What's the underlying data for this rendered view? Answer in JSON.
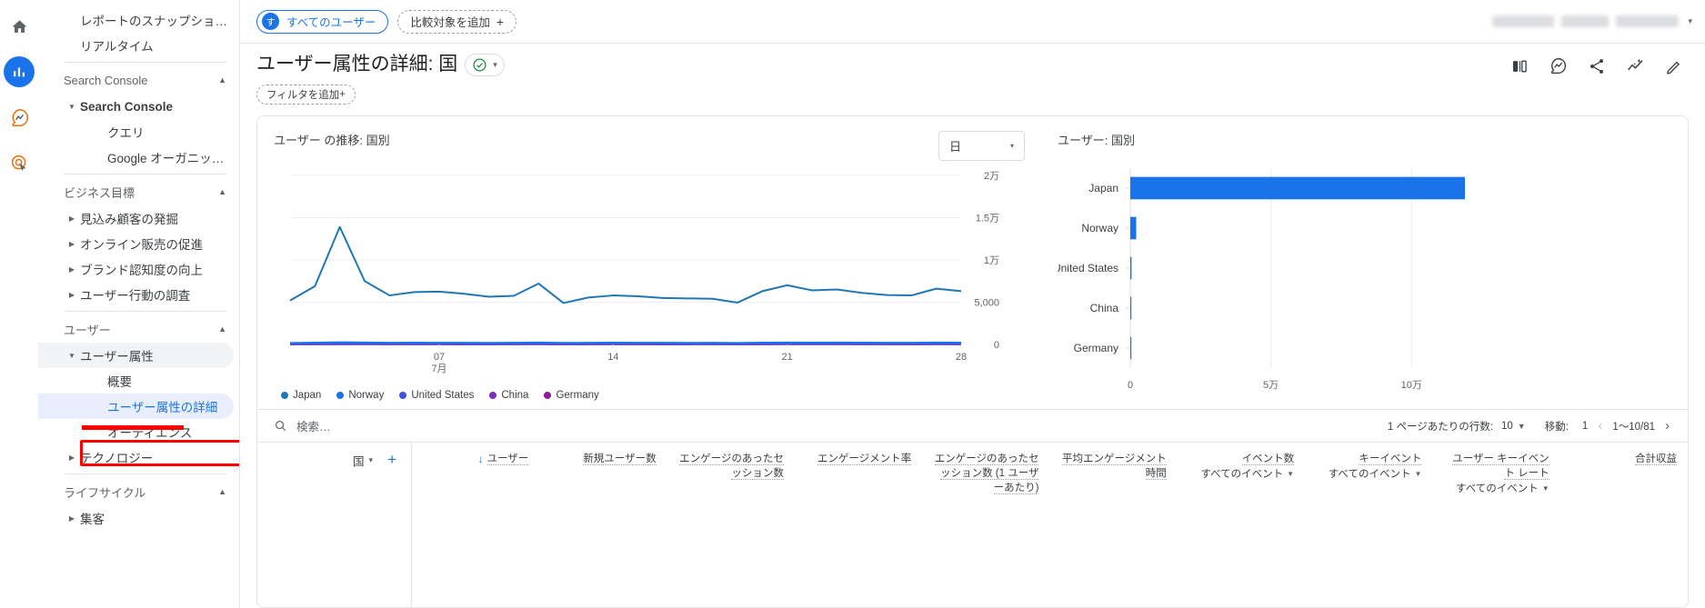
{
  "rail": {
    "items": [
      {
        "name": "home-icon",
        "label": "ホーム"
      },
      {
        "name": "reports-icon",
        "label": "レポート"
      },
      {
        "name": "explore-icon",
        "label": "探索"
      },
      {
        "name": "advertising-icon",
        "label": "広告"
      }
    ]
  },
  "sidebar": {
    "items": [
      {
        "label": "レポートのスナップショット",
        "type": "item"
      },
      {
        "label": "リアルタイム",
        "type": "item"
      },
      {
        "label": "Search Console",
        "type": "section"
      },
      {
        "label": "Search Console",
        "type": "expander-open",
        "bold": true
      },
      {
        "label": "クエリ",
        "type": "sub"
      },
      {
        "label": "Google オーガニック検索レ...",
        "type": "sub"
      },
      {
        "label": "ビジネス目標",
        "type": "section"
      },
      {
        "label": "見込み顧客の発掘",
        "type": "expander"
      },
      {
        "label": "オンライン販売の促進",
        "type": "expander"
      },
      {
        "label": "ブランド認知度の向上",
        "type": "expander"
      },
      {
        "label": "ユーザー行動の調査",
        "type": "expander"
      },
      {
        "label": "ユーザー",
        "type": "section"
      },
      {
        "label": "ユーザー属性",
        "type": "expander-open"
      },
      {
        "label": "概要",
        "type": "sub"
      },
      {
        "label": "ユーザー属性の詳細",
        "type": "sub-selected"
      },
      {
        "label": "オーディエンス",
        "type": "sub"
      },
      {
        "label": "テクノロジー",
        "type": "expander"
      },
      {
        "label": "ライフサイクル",
        "type": "section"
      },
      {
        "label": "集客",
        "type": "expander"
      }
    ],
    "annotation_color": "#ff0000"
  },
  "topbar": {
    "audience_chip": "すべてのユーザー",
    "audience_badge": "す",
    "compare_chip": "比較対象を追加",
    "plus": "+",
    "account_dropdown_caret": "▾"
  },
  "header": {
    "title": "ユーザー属性の詳細: 国",
    "check_icon": "check-circle",
    "caret": "▾",
    "filter_chip": "フィルタを追加",
    "filter_plus": "+",
    "icons": [
      {
        "name": "compare-panel-icon"
      },
      {
        "name": "insights-icon"
      },
      {
        "name": "share-icon"
      },
      {
        "name": "sparkline-insights-icon"
      },
      {
        "name": "edit-pencil-icon"
      }
    ]
  },
  "line_card": {
    "title": "ユーザー の推移: 国別",
    "granularity": "日",
    "granularity_caret": "▾"
  },
  "bar_card": {
    "title": "ユーザー: 国別"
  },
  "table": {
    "search_placeholder": "検索…",
    "search_icon": "search-icon",
    "rows_per_page_label": "1 ページあたりの行数:",
    "rows_per_page_value": "10",
    "goto_label": "移動:",
    "goto_value": "1",
    "range_label": "1〜10/81",
    "prev": "‹",
    "next": "›",
    "dimension_header": "国",
    "dimension_caret": "▾",
    "add_dimension": "+",
    "sort_arrow": "↓",
    "metrics": [
      {
        "title": "ユーザー",
        "sub": "",
        "sorted": true
      },
      {
        "title": "新規ユーザー数",
        "sub": ""
      },
      {
        "title": "エンゲージのあったセッション数",
        "sub": ""
      },
      {
        "title": "エンゲージメント率",
        "sub": ""
      },
      {
        "title": "エンゲージのあったセッション数 (1 ユーザーあたり)",
        "sub": ""
      },
      {
        "title": "平均エンゲージメント時間",
        "sub": ""
      },
      {
        "title": "イベント数",
        "sub": "すべてのイベント"
      },
      {
        "title": "キーイベント",
        "sub": "すべてのイベント"
      },
      {
        "title": "ユーザー キーイベント レート",
        "sub": "すべてのイベント"
      },
      {
        "title": "合計収益",
        "sub": ""
      }
    ]
  },
  "chart_data": [
    {
      "type": "line",
      "title": "ユーザー の推移: 国別",
      "xlabel": "",
      "ylabel": "",
      "ylim": [
        0,
        20000
      ],
      "yticks": [
        0,
        5000,
        10000,
        15000,
        20000
      ],
      "ytick_labels": [
        "0",
        "5,000",
        "1万",
        "1.5万",
        "2万"
      ],
      "xticks": [
        7,
        14,
        21,
        28
      ],
      "xtick_labels": [
        "07",
        "14",
        "21",
        "28"
      ],
      "xtick_sublabel": "7月",
      "grid": true,
      "legend_position": "bottom",
      "series": [
        {
          "name": "Japan",
          "color": "#1f77b4",
          "values": [
            5200,
            6900,
            13900,
            7500,
            5800,
            6200,
            6250,
            6000,
            5650,
            5750,
            7200,
            4900,
            5550,
            5800,
            5700,
            5500,
            5450,
            5400,
            4950,
            6300,
            7000,
            6400,
            6500,
            6100,
            5850,
            5800,
            6600,
            6300
          ]
        },
        {
          "name": "Norway",
          "color": "#1a73e8",
          "values": [
            180,
            210,
            260,
            230,
            200,
            215,
            205,
            195,
            190,
            200,
            230,
            185,
            200,
            210,
            205,
            195,
            190,
            195,
            180,
            215,
            235,
            220,
            225,
            210,
            200,
            195,
            225,
            215
          ]
        },
        {
          "name": "United States",
          "color": "#3f51e0",
          "values": [
            70,
            75,
            95,
            85,
            72,
            78,
            75,
            70,
            68,
            72,
            86,
            66,
            72,
            76,
            74,
            70,
            68,
            70,
            64,
            78,
            85,
            80,
            82,
            76,
            72,
            70,
            82,
            78
          ]
        },
        {
          "name": "China",
          "color": "#7b2fbe",
          "values": [
            30,
            32,
            40,
            36,
            31,
            33,
            32,
            30,
            29,
            31,
            37,
            28,
            31,
            33,
            32,
            30,
            29,
            30,
            27,
            33,
            36,
            34,
            35,
            32,
            31,
            30,
            35,
            33
          ]
        },
        {
          "name": "Germany",
          "color": "#8e1a9b",
          "values": [
            20,
            22,
            28,
            25,
            21,
            23,
            22,
            20,
            20,
            21,
            25,
            19,
            21,
            23,
            22,
            20,
            20,
            21,
            18,
            23,
            25,
            24,
            24,
            22,
            21,
            20,
            24,
            23
          ]
        }
      ]
    },
    {
      "type": "bar",
      "orientation": "horizontal",
      "title": "ユーザー: 国別",
      "categories": [
        "Japan",
        "Norway",
        "United States",
        "China",
        "Germany"
      ],
      "values": [
        119000,
        2100,
        450,
        120,
        90
      ],
      "xlim": [
        0,
        130000
      ],
      "xticks": [
        0,
        50000,
        100000
      ],
      "xtick_labels": [
        "0",
        "5万",
        "10万"
      ],
      "bar_color": "#1a73e8",
      "grid": true
    }
  ]
}
